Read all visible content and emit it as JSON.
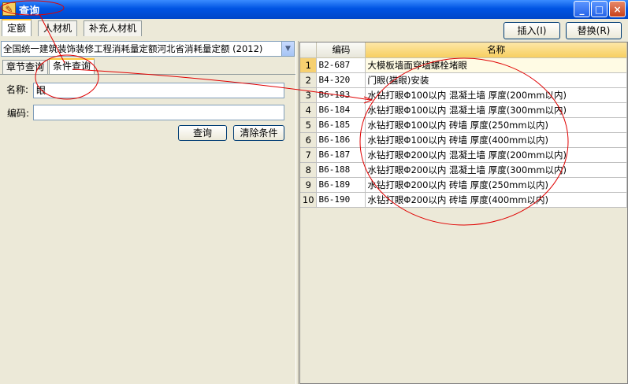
{
  "window": {
    "title": "查询",
    "minimize": "_",
    "maximize": "□",
    "close": "×"
  },
  "top_tabs": [
    "定额",
    "人材机",
    "补充人材机"
  ],
  "buttons": {
    "insert": "插入(I)",
    "replace": "替换(R)",
    "query": "查询",
    "clear": "清除条件"
  },
  "quota_selector": {
    "value": "全国统一建筑装饰装修工程消耗量定额河北省消耗量定额 (2012)"
  },
  "sub_tabs": [
    "章节查询",
    "条件查询"
  ],
  "form": {
    "name_label": "名称:",
    "name_value": "眼",
    "code_label": "编码:",
    "code_value": ""
  },
  "grid": {
    "columns": [
      "编码",
      "名称"
    ],
    "rows": [
      {
        "n": "1",
        "code": "B2-687",
        "name": "大模板墙面穿墙螺栓堵眼"
      },
      {
        "n": "2",
        "code": "B4-320",
        "name": "门眼(猫眼)安装"
      },
      {
        "n": "3",
        "code": "B6-183",
        "name": "水钻打眼Φ100以内 混凝土墙 厚度(200mm以内)"
      },
      {
        "n": "4",
        "code": "B6-184",
        "name": "水钻打眼Φ100以内 混凝土墙 厚度(300mm以内)"
      },
      {
        "n": "5",
        "code": "B6-185",
        "name": "水钻打眼Φ100以内 砖墙 厚度(250mm以内)"
      },
      {
        "n": "6",
        "code": "B6-186",
        "name": "水钻打眼Φ100以内 砖墙 厚度(400mm以内)"
      },
      {
        "n": "7",
        "code": "B6-187",
        "name": "水钻打眼Φ200以内 混凝土墙 厚度(200mm以内)"
      },
      {
        "n": "8",
        "code": "B6-188",
        "name": "水钻打眼Φ200以内 混凝土墙 厚度(300mm以内)"
      },
      {
        "n": "9",
        "code": "B6-189",
        "name": "水钻打眼Φ200以内 砖墙 厚度(250mm以内)"
      },
      {
        "n": "10",
        "code": "B6-190",
        "name": "水钻打眼Φ200以内 砖墙 厚度(400mm以内)"
      }
    ]
  },
  "colors": {
    "annotation": "#e00000",
    "titlebar": "#0054e3"
  }
}
